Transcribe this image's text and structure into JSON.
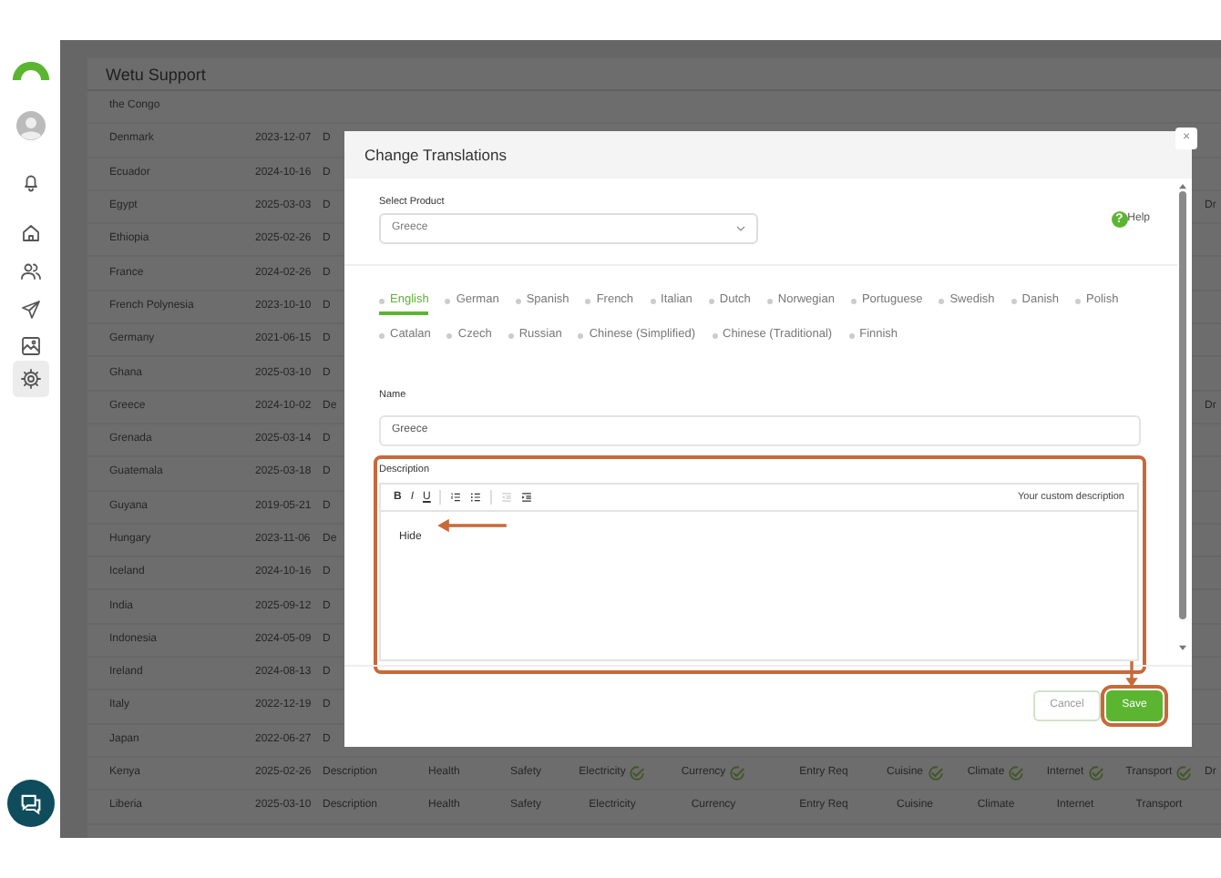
{
  "sidebar": {
    "items": [
      {
        "kind": "notifications",
        "selected": false
      },
      {
        "kind": "home",
        "selected": false
      },
      {
        "kind": "people",
        "selected": false
      },
      {
        "kind": "send",
        "selected": false
      },
      {
        "kind": "gallery",
        "selected": false
      },
      {
        "kind": "settings",
        "selected": true
      }
    ]
  },
  "page": {
    "title": "Wetu Support"
  },
  "table": {
    "rows": [
      {
        "name": "the Congo",
        "date": "",
        "cells": []
      },
      {
        "name": "Denmark",
        "date": "2023-12-07",
        "cells": [
          {
            "text": "D",
            "verified": false
          }
        ]
      },
      {
        "name": "Ecuador",
        "date": "2024-10-16",
        "cells": [
          {
            "text": "D",
            "verified": false
          }
        ]
      },
      {
        "name": "Egypt",
        "date": "2025-03-03",
        "cells": [
          {
            "text": "D",
            "verified": false
          }
        ],
        "tail": "Dr"
      },
      {
        "name": "Ethiopia",
        "date": "2025-02-26",
        "cells": [
          {
            "text": "D",
            "verified": false
          }
        ]
      },
      {
        "name": "France",
        "date": "2024-02-26",
        "cells": [
          {
            "text": "D",
            "verified": false
          }
        ]
      },
      {
        "name": "French Polynesia",
        "date": "2023-10-10",
        "cells": [
          {
            "text": "D",
            "verified": false
          }
        ]
      },
      {
        "name": "Germany",
        "date": "2021-06-15",
        "cells": [
          {
            "text": "D",
            "verified": false
          }
        ]
      },
      {
        "name": "Ghana",
        "date": "2025-03-10",
        "cells": [
          {
            "text": "D",
            "verified": false
          }
        ]
      },
      {
        "name": "Greece",
        "date": "2024-10-02",
        "cells": [
          {
            "text": "De",
            "verified": false
          }
        ],
        "tail": "Dr"
      },
      {
        "name": "Grenada",
        "date": "2025-03-14",
        "cells": [
          {
            "text": "D",
            "verified": false
          }
        ]
      },
      {
        "name": "Guatemala",
        "date": "2025-03-18",
        "cells": [
          {
            "text": "D",
            "verified": false
          }
        ]
      },
      {
        "name": "Guyana",
        "date": "2019-05-21",
        "cells": [
          {
            "text": "D",
            "verified": false
          }
        ]
      },
      {
        "name": "Hungary",
        "date": "2023-11-06",
        "cells": [
          {
            "text": "De",
            "verified": false
          }
        ]
      },
      {
        "name": "Iceland",
        "date": "2024-10-16",
        "cells": [
          {
            "text": "D",
            "verified": false
          }
        ]
      },
      {
        "name": "India",
        "date": "2025-09-12",
        "cells": [
          {
            "text": "D",
            "verified": false
          }
        ]
      },
      {
        "name": "Indonesia",
        "date": "2024-05-09",
        "cells": [
          {
            "text": "D",
            "verified": false
          }
        ]
      },
      {
        "name": "Ireland",
        "date": "2024-08-13",
        "cells": [
          {
            "text": "D",
            "verified": false
          }
        ]
      },
      {
        "name": "Italy",
        "date": "2022-12-19",
        "cells": [
          {
            "text": "D",
            "verified": false
          }
        ]
      },
      {
        "name": "Japan",
        "date": "2022-06-27",
        "cells": [
          {
            "text": "D",
            "verified": false
          }
        ]
      },
      {
        "name": "Kenya",
        "date": "2025-02-26",
        "cells": [
          {
            "text": "Description",
            "verified": false
          },
          {
            "text": "Health",
            "verified": false
          },
          {
            "text": "Safety",
            "verified": false
          },
          {
            "text": "Electricity",
            "verified": true
          },
          {
            "text": "Currency",
            "verified": true
          },
          {
            "text": "Entry Req",
            "verified": false
          },
          {
            "text": "Cuisine",
            "verified": true
          },
          {
            "text": "Climate",
            "verified": true
          },
          {
            "text": "Internet",
            "verified": true
          },
          {
            "text": "Transport",
            "verified": true
          }
        ],
        "tail": "Dr"
      },
      {
        "name": "Liberia",
        "date": "2025-03-10",
        "cells": [
          {
            "text": "Description",
            "verified": false
          },
          {
            "text": "Health",
            "verified": false
          },
          {
            "text": "Safety",
            "verified": false
          },
          {
            "text": "Electricity",
            "verified": false
          },
          {
            "text": "Currency",
            "verified": false
          },
          {
            "text": "Entry Req",
            "verified": false
          },
          {
            "text": "Cuisine",
            "verified": false
          },
          {
            "text": "Climate",
            "verified": false
          },
          {
            "text": "Internet",
            "verified": false
          },
          {
            "text": "Transport",
            "verified": false
          }
        ]
      }
    ]
  },
  "dialog": {
    "title": "Change Translations",
    "close": "×",
    "product": {
      "label": "Select Product",
      "value": "Greece"
    },
    "help": {
      "icon": "?",
      "label": "Help"
    },
    "languages": [
      {
        "label": "English",
        "selected": true
      },
      {
        "label": "German",
        "selected": false
      },
      {
        "label": "Spanish",
        "selected": false
      },
      {
        "label": "French",
        "selected": false
      },
      {
        "label": "Italian",
        "selected": false
      },
      {
        "label": "Dutch",
        "selected": false
      },
      {
        "label": "Norwegian",
        "selected": false
      },
      {
        "label": "Portuguese",
        "selected": false
      },
      {
        "label": "Swedish",
        "selected": false
      },
      {
        "label": "Danish",
        "selected": false
      },
      {
        "label": "Polish",
        "selected": false
      },
      {
        "label": "Catalan",
        "selected": false
      },
      {
        "label": "Czech",
        "selected": false
      },
      {
        "label": "Russian",
        "selected": false
      },
      {
        "label": "Chinese (Simplified)",
        "selected": false
      },
      {
        "label": "Chinese (Traditional)",
        "selected": false
      },
      {
        "label": "Finnish",
        "selected": false
      }
    ],
    "name": {
      "label": "Name",
      "value": "Greece"
    },
    "description": {
      "label": "Description",
      "hint": "Your custom description",
      "content": "Hide",
      "toolbar": [
        {
          "kind": "bold",
          "label": "B",
          "disabled": false
        },
        {
          "kind": "italic",
          "label": "I",
          "disabled": false
        },
        {
          "kind": "underline",
          "label": "U",
          "disabled": false
        },
        {
          "kind": "separator"
        },
        {
          "kind": "ordered-list",
          "disabled": false
        },
        {
          "kind": "bullet-list",
          "disabled": false
        },
        {
          "kind": "separator"
        },
        {
          "kind": "outdent",
          "disabled": true
        },
        {
          "kind": "indent",
          "disabled": false
        }
      ]
    },
    "buttons": [
      {
        "label": "Cancel",
        "kind": "secondary"
      },
      {
        "label": "Save",
        "kind": "primary"
      }
    ]
  }
}
